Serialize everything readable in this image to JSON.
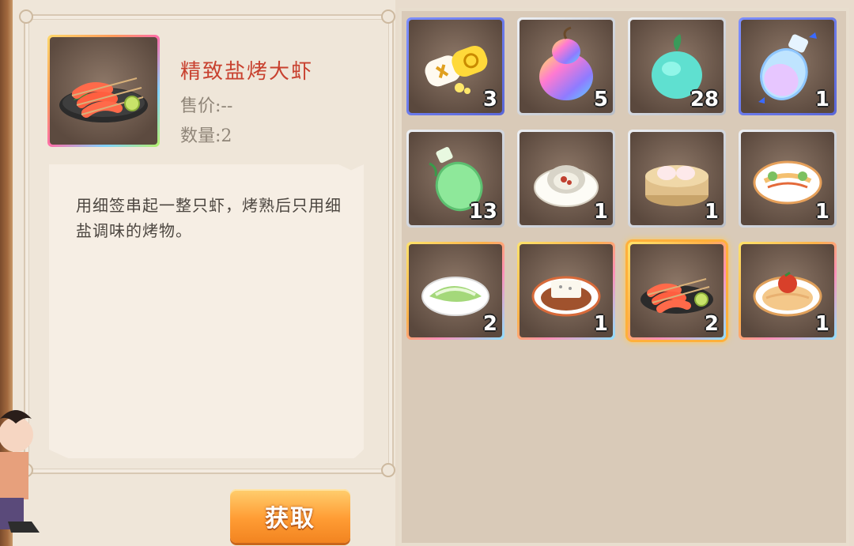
{
  "detail": {
    "name": "精致盐烤大虾",
    "price": "售价:--",
    "quantity": "数量:2",
    "description": "用细签串起一整只虾，烤熟后只用细盐调味的烤物。"
  },
  "actions": {
    "get_label": "获取"
  },
  "inventory": [
    {
      "icon": "battery-pill-icon",
      "count": "3",
      "rarity": "blue"
    },
    {
      "icon": "rainbow-gourd-icon",
      "count": "5",
      "rarity": "gray"
    },
    {
      "icon": "cyan-gourd-icon",
      "count": "28",
      "rarity": "gray"
    },
    {
      "icon": "butterfly-potion-icon",
      "count": "1",
      "rarity": "blue"
    },
    {
      "icon": "green-potion-icon",
      "count": "13",
      "rarity": "gray"
    },
    {
      "icon": "oyster-dish-icon",
      "count": "1",
      "rarity": "gray"
    },
    {
      "icon": "dumpling-steamer-icon",
      "count": "1",
      "rarity": "gray"
    },
    {
      "icon": "noodle-salad-icon",
      "count": "1",
      "rarity": "gray"
    },
    {
      "icon": "lettuce-dish-icon",
      "count": "2",
      "rarity": "gold"
    },
    {
      "icon": "tofu-dish-icon",
      "count": "1",
      "rarity": "gold"
    },
    {
      "icon": "grilled-shrimp-icon",
      "count": "2",
      "rarity": "gold",
      "selected": true
    },
    {
      "icon": "noodle-tomato-icon",
      "count": "1",
      "rarity": "gold"
    }
  ]
}
